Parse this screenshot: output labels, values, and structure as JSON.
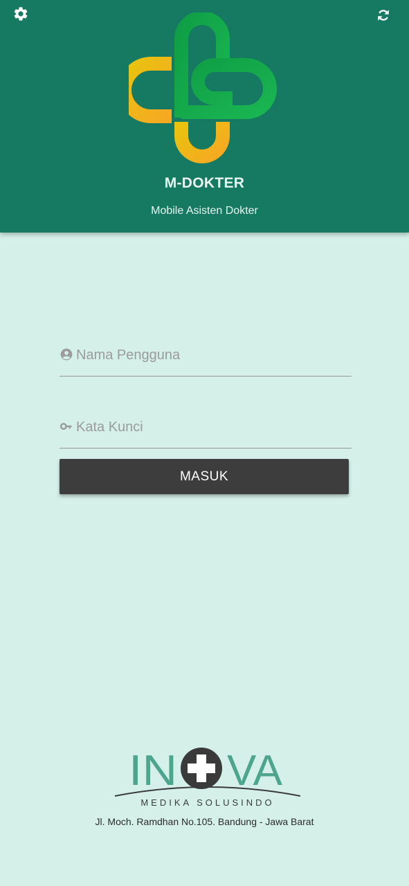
{
  "header": {
    "settings_icon": "gear-icon",
    "refresh_icon": "refresh-icon",
    "title": "M-DOKTER",
    "subtitle": "Mobile Asisten Dokter",
    "background_color": "#167a62"
  },
  "form": {
    "username": {
      "placeholder": "Nama Pengguna",
      "value": "",
      "icon": "user-circle-icon"
    },
    "password": {
      "placeholder": "Kata Kunci",
      "value": "",
      "icon": "key-icon"
    },
    "submit_label": "MASUK"
  },
  "footer": {
    "company_name_part1": "IN",
    "company_name_part2": "VA",
    "company_tagline": "MEDIKA SOLUSINDO",
    "address": "Jl. Moch. Ramdhan No.105. Bandung - Jawa Barat"
  },
  "colors": {
    "page_background": "#d5f0e9",
    "button": "#3d3d3d",
    "logo_green": "#14a84a",
    "logo_yellow": "#f5c518",
    "brand_teal": "#4ea58e"
  }
}
